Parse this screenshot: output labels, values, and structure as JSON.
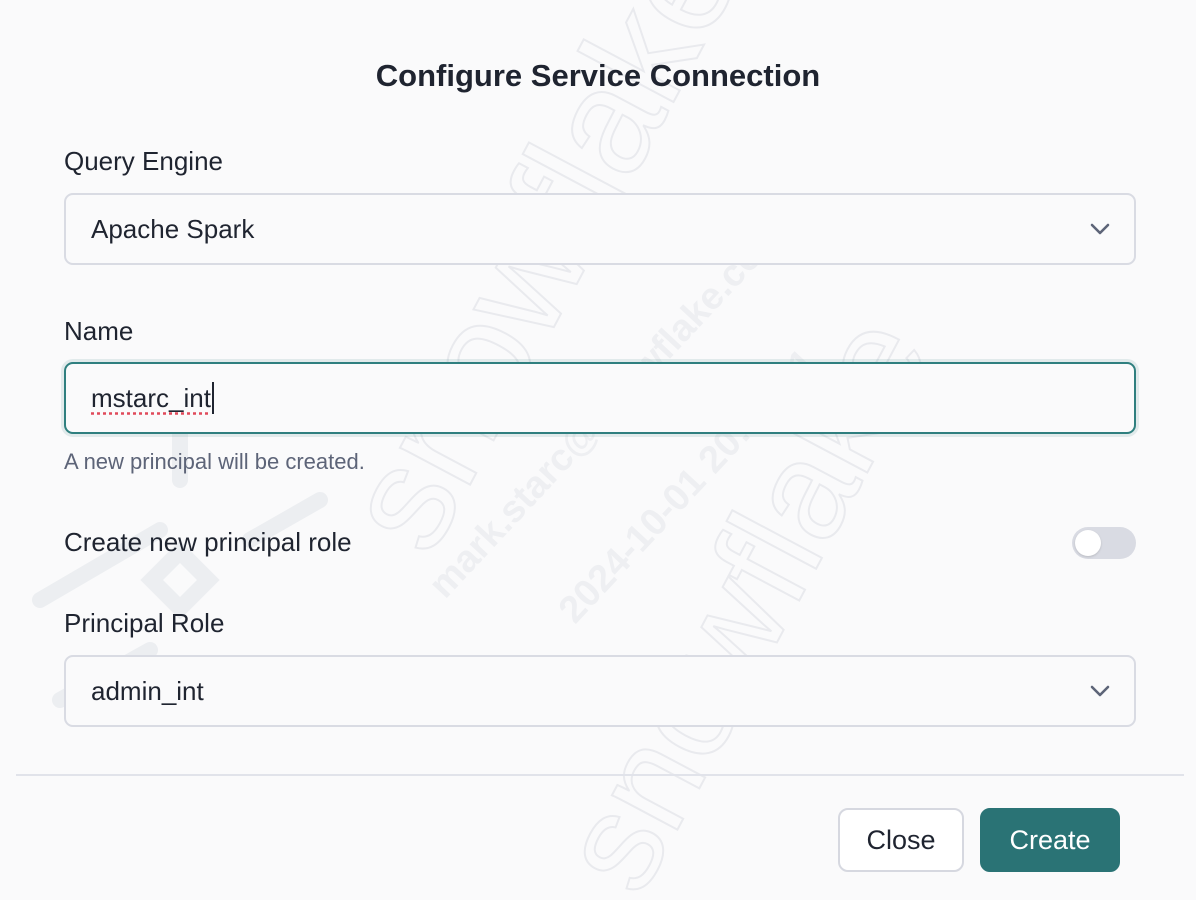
{
  "dialog": {
    "title": "Configure Service Connection"
  },
  "query_engine": {
    "label": "Query Engine",
    "value": "Apache Spark",
    "chevron_icon": "chevron-down-icon"
  },
  "name": {
    "label": "Name",
    "value": "mstarc_int",
    "helper": "A new principal will be created."
  },
  "create_principal_role": {
    "label": "Create new principal role",
    "enabled": false
  },
  "principal_role": {
    "label": "Principal Role",
    "value": "admin_int",
    "chevron_icon": "chevron-down-icon"
  },
  "footer": {
    "close_label": "Close",
    "create_label": "Create"
  },
  "watermark": {
    "lines": [
      "snowflake",
      "mark.starc@snowflake.co",
      "m",
      "2024-10-01 20:51:51",
      "snowflake"
    ]
  },
  "colors": {
    "accent": "#2a7375",
    "focus_border": "#2f7f7f",
    "toggle_off": "#d9dbe3"
  }
}
